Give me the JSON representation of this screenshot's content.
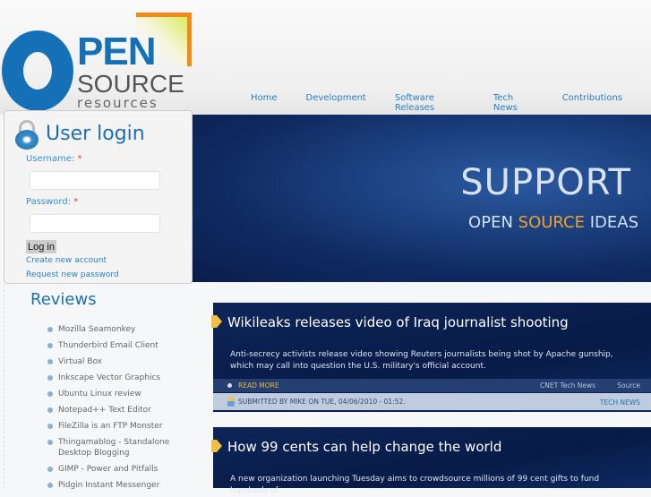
{
  "logo": {
    "line1": "PEN",
    "line2": "SOURCE",
    "line3": "resources"
  },
  "nav": [
    "Home",
    "Development",
    "Software Releases",
    "Tech News",
    "Contributions"
  ],
  "banner": {
    "line1": "SUPPORT",
    "open": "OPEN",
    "source": "SOURCE",
    "ideas": "IDEAS"
  },
  "login": {
    "title": "User login",
    "username_label": "Username:",
    "password_label": "Password:",
    "required": "*",
    "username_value": "",
    "password_value": "",
    "submit": "Log in",
    "create": "Create new account",
    "request": "Request new password"
  },
  "reviews": {
    "title": "Reviews",
    "items": [
      "Mozilla Seamonkey",
      "Thunderbird Email Client",
      "Virtual Box",
      "Inkscape Vector Graphics",
      "Ubuntu Linux review",
      "Notepad++ Text Editor",
      "FileZilla is an FTP Monster",
      "Thingamablog - Standalone Desktop Blogging",
      "GIMP - Power and Pitfalls",
      "Pidgin Instant Messenger"
    ]
  },
  "articles": [
    {
      "title": "Wikileaks releases video of Iraq journalist shooting",
      "body": "Anti-secrecy activists release video showing Reuters journalists being shot by Apache gunship, which may call into question the U.S. military's official account.",
      "read_more": "READ MORE",
      "source_name": "CNET Tech News",
      "source_label": "Source",
      "submitted": "SUBMITTED BY MIKE ON TUE, 04/06/2010 - 01:52.",
      "category": "TECH NEWS"
    },
    {
      "title": "How 99 cents can help change the world",
      "body": "A new organization launching Tuesday aims to crowdsource millions of 99 cent gifts to fund hundreds of"
    }
  ]
}
